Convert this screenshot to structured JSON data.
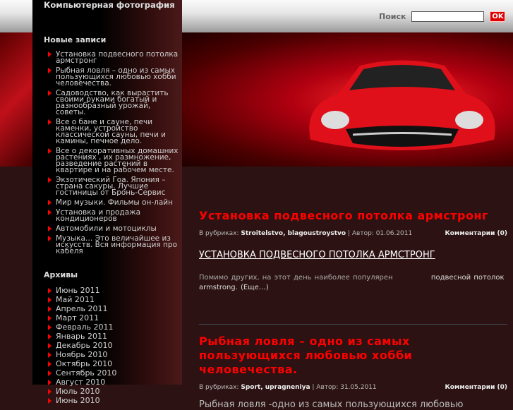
{
  "site_title": "Компьютерная фотография",
  "search": {
    "label": "Поиск",
    "button": "OK",
    "value": ""
  },
  "sidebar": {
    "recent_title": "Новые записи",
    "recent": [
      "Установка подвесного потолка армстронг",
      "Рыбная ловля – одно из самых пользующихся любовью хобби человечества.",
      "Садоводство, как вырастить своими руками богатый и разнообразный урожай, советы.",
      "Все о бане и сауне, печи каменки, устройство классической сауны, печи и камины, печное дело.",
      "Все о декоративных домашних растениях , их размножение, разведение растений в квартире и на рабочем месте.",
      "Экзотический Гоа. Япония – страна сакуры. Лучшие гостиницы от Бронь-Сервис",
      "Мир музыки. Фильмы он-лайн",
      "Установка и продажа кондиционеров",
      "Автомобили и мотоциклы",
      "Музыка… Это величайшее из искусств. Вся информация про кабеля"
    ],
    "archives_title": "Архивы",
    "archives": [
      "Июнь 2011",
      "Май 2011",
      "Апрель 2011",
      "Март 2011",
      "Февраль 2011",
      "Январь 2011",
      "Декабрь 2010",
      "Ноябрь 2010",
      "Октябрь 2010",
      "Сентябрь 2010",
      "Август 2010",
      "Июль 2010",
      "Июнь 2010"
    ]
  },
  "posts": [
    {
      "title": "Установка подвесного потолка армстронг",
      "cat_label": "В рубриках:",
      "cats": "Stroitelstvo, blagoustroystvo",
      "author": "| Автор: 01.06.2011",
      "comments": "Комментарии (0)",
      "subtitle": "УСТАНОВКА ПОДВЕСНОГО ПОТОЛКА АРМСТРОНГ",
      "excerpt": "Помимо других, на этот день наиболее популярен",
      "link": "подвесной потолок armstrong.",
      "more": "(Еще…)"
    },
    {
      "title": "Рыбная ловля – одно из самых пользующихся любовью хобби человечества.",
      "cat_label": "В рубриках:",
      "cats": "Sport, upragneniya",
      "author": "| Автор: 31.05.2011",
      "comments": "Комментарии (0)",
      "excerpt": "Рыбная ловля  -одно из самых    пользующихся любовью"
    }
  ]
}
